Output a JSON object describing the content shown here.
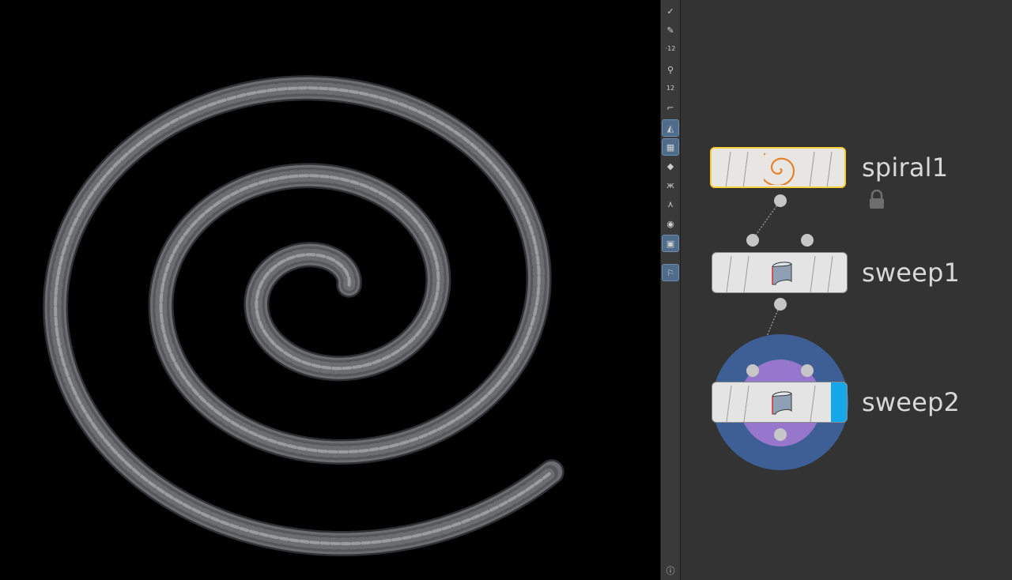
{
  "viewport": {
    "scene": "spiral-rope-render",
    "colors": {
      "background": "#000000",
      "rope": "#6b6d70",
      "rope_highlight": "#9a9ca0",
      "rope_shadow": "#2e3033"
    }
  },
  "toolbar": {
    "tools": [
      {
        "name": "select-tool",
        "icon": "brush-icon",
        "glyph": "✓",
        "active": false
      },
      {
        "name": "pen-tool",
        "icon": "pen-icon",
        "glyph": "✎",
        "active": false
      },
      {
        "name": "point-number-tool",
        "icon": "point-numbers-icon",
        "glyph": "·12",
        "active": false
      },
      {
        "name": "primitive-tool",
        "icon": "primitive-icon",
        "glyph": "⚲",
        "active": false
      },
      {
        "name": "primitive-number-tool",
        "icon": "primitive-numbers-icon",
        "glyph": "12",
        "active": false
      },
      {
        "name": "corner-tool",
        "icon": "corner-icon",
        "glyph": "⌐",
        "active": false
      },
      {
        "name": "shading-tool",
        "icon": "shading-icon",
        "glyph": "◭",
        "active": true
      },
      {
        "name": "texture-tool",
        "icon": "checker-icon",
        "glyph": "▦",
        "active": true
      },
      {
        "name": "ghost-tool",
        "icon": "diamond-icon",
        "glyph": "◆",
        "active": false
      },
      {
        "name": "display-tool",
        "icon": "butterfly-icon",
        "glyph": "ж",
        "active": false
      },
      {
        "name": "axis-tool",
        "icon": "axis-icon",
        "glyph": "⋏",
        "active": false
      },
      {
        "name": "stop-tool",
        "icon": "circle-stop-icon",
        "glyph": "◉",
        "active": false
      },
      {
        "name": "background-tool",
        "icon": "image-icon",
        "glyph": "▣",
        "active": true
      },
      {
        "name": "snap-tool",
        "icon": "pin-icon",
        "glyph": "⚐",
        "active": true
      },
      {
        "name": "info-tool",
        "icon": "info-icon",
        "glyph": "ⓘ",
        "active": false
      }
    ]
  },
  "network": {
    "colors": {
      "background": "#333333",
      "node_body": "#e4e4e4",
      "selected_border": "#f5cc3a",
      "display_flag": "#14a7ea",
      "halo_outer": "#3e5f96",
      "halo_inner": "#9677cc",
      "label": "#d8d8d8",
      "wire": "#a0a0a0",
      "spiral_icon": "#e8822a"
    },
    "nodes": [
      {
        "id": "spiral1",
        "label": "spiral1",
        "icon": "spiral-icon",
        "selected": true,
        "locked": true,
        "display": false
      },
      {
        "id": "sweep1",
        "label": "sweep1",
        "icon": "sweep-icon",
        "selected": false,
        "locked": false,
        "display": false
      },
      {
        "id": "sweep2",
        "label": "sweep2",
        "icon": "sweep-icon",
        "selected": false,
        "locked": false,
        "display": true
      }
    ]
  }
}
